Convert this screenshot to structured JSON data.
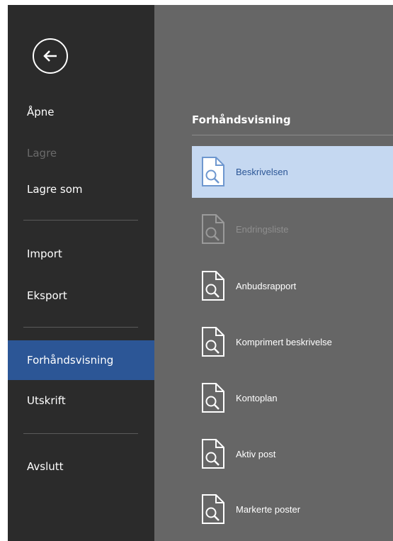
{
  "sidebar": {
    "items": [
      {
        "label": "Åpne",
        "state": "normal"
      },
      {
        "label": "Lagre",
        "state": "disabled"
      },
      {
        "label": "Lagre som",
        "state": "normal"
      },
      {
        "label": "Import",
        "state": "normal"
      },
      {
        "label": "Eksport",
        "state": "normal"
      },
      {
        "label": "Forhåndsvisning",
        "state": "selected"
      },
      {
        "label": "Utskrift",
        "state": "normal"
      },
      {
        "label": "Avslutt",
        "state": "normal"
      }
    ]
  },
  "main": {
    "section_title": "Forhåndsvisning",
    "items": [
      {
        "label": "Beskrivelsen",
        "state": "selected"
      },
      {
        "label": "Endringsliste",
        "state": "disabled"
      },
      {
        "label": "Anbudsrapport",
        "state": "normal"
      },
      {
        "label": "Komprimert beskrivelse",
        "state": "normal"
      },
      {
        "label": "Kontoplan",
        "state": "normal"
      },
      {
        "label": "Aktiv post",
        "state": "normal"
      },
      {
        "label": "Markerte poster",
        "state": "normal"
      }
    ]
  },
  "icons": {
    "back": "back-arrow-icon",
    "preview": "document-search-icon"
  },
  "colors": {
    "sidebar_bg": "#2b2b2b",
    "content_bg": "#666666",
    "accent": "#2c5696",
    "selected_item_bg": "#c5d8f1",
    "disabled_text": "#6a6a6a"
  }
}
